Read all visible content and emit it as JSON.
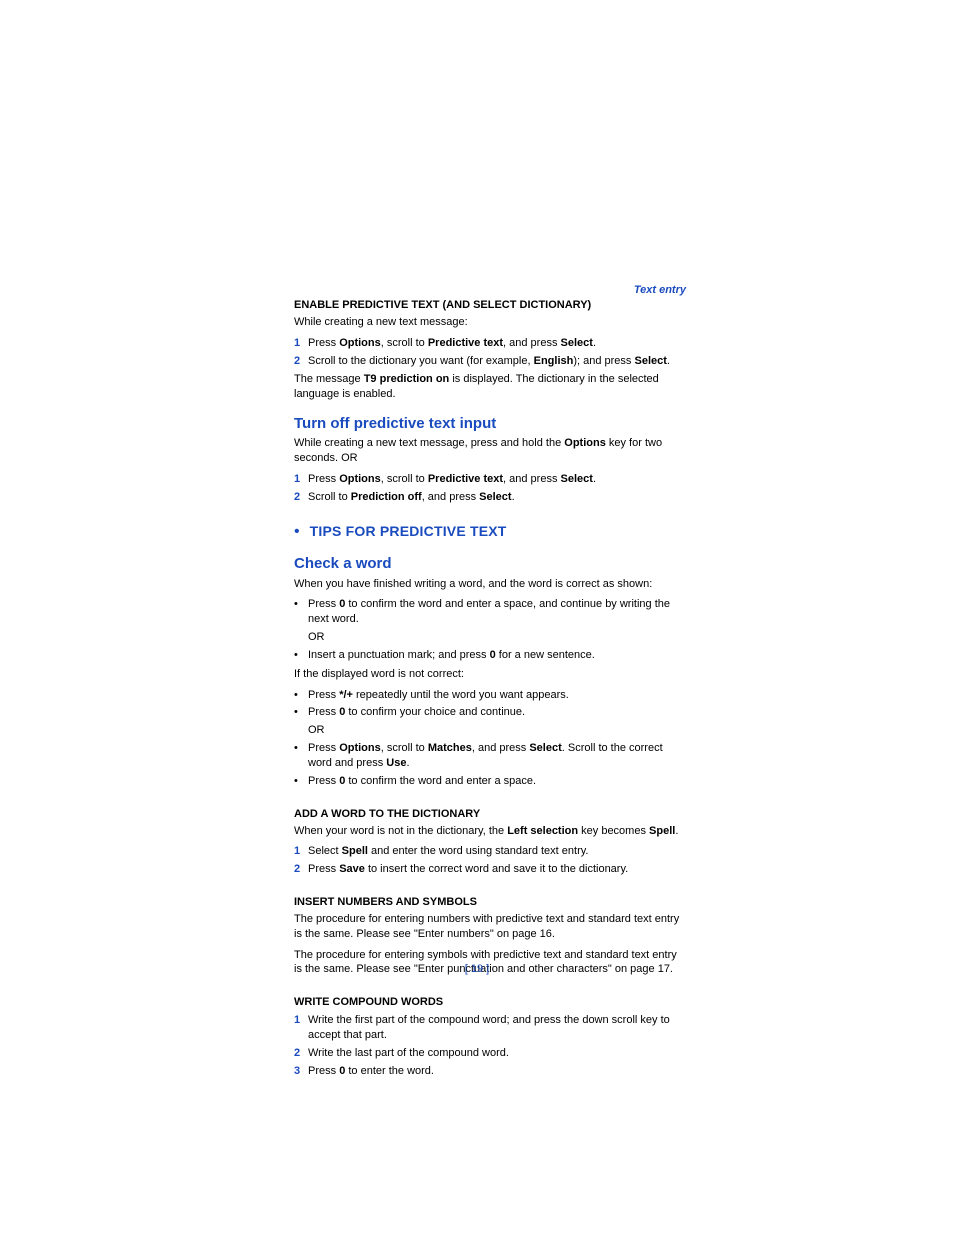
{
  "header": {
    "right": "Text entry"
  },
  "s1": {
    "title": "ENABLE PREDICTIVE TEXT (AND SELECT DICTIONARY)",
    "intro": "While creating a new text message:",
    "step1": {
      "a": "Press ",
      "b": "Options",
      "c": ", scroll to ",
      "d": "Predictive text",
      "e": ", and press ",
      "f": "Select",
      "g": "."
    },
    "step2": {
      "a": "Scroll to the dictionary you want (for example, ",
      "b": "English",
      "c": "); and press ",
      "d": "Select",
      "e": "."
    },
    "after": {
      "a": "The message ",
      "b": "T9 prediction on",
      "c": " is displayed. The dictionary in the selected language is enabled."
    }
  },
  "s2": {
    "title": "Turn off predictive text input",
    "intro": {
      "a": "While creating a new text message, press and hold the ",
      "b": "Options",
      "c": " key for two seconds. OR"
    },
    "step1": {
      "a": "Press ",
      "b": "Options",
      "c": ", scroll to ",
      "d": "Predictive text",
      "e": ", and press ",
      "f": "Select",
      "g": "."
    },
    "step2": {
      "a": "Scroll to ",
      "b": "Prediction off",
      "c": ", and press ",
      "d": "Select",
      "e": "."
    }
  },
  "tips": {
    "title": "TIPS FOR PREDICTIVE TEXT"
  },
  "check": {
    "title": "Check a word",
    "intro": "When you have finished writing a word, and the word is correct as shown:",
    "b1": {
      "a": "Press ",
      "b": "0",
      "c": " to confirm the word and enter a space, and continue by writing the next word."
    },
    "or1": "OR",
    "b2": {
      "a": "Insert a punctuation mark; and press ",
      "b": "0",
      "c": " for a new sentence."
    },
    "mid": "If the displayed word is not correct:",
    "b3": {
      "a": "Press ",
      "b": "*/+",
      "c": " repeatedly until the word you want appears."
    },
    "b4": {
      "a": "Press ",
      "b": "0",
      "c": " to confirm your choice and continue."
    },
    "or2": "OR",
    "b5": {
      "a": "Press ",
      "b": "Options",
      "c": ", scroll to ",
      "d": "Matches",
      "e": ", and press ",
      "f": "Select",
      "g": ". Scroll to the correct word and press ",
      "h": "Use",
      "i": "."
    },
    "b6": {
      "a": "Press ",
      "b": "0",
      "c": " to confirm the word and enter a space."
    }
  },
  "add": {
    "title": "ADD A WORD TO THE DICTIONARY",
    "intro": {
      "a": "When your word is not in the dictionary, the ",
      "b": "Left selection",
      "c": " key becomes ",
      "d": "Spell",
      "e": "."
    },
    "step1": {
      "a": "Select ",
      "b": "Spell",
      "c": " and enter the word using standard text entry."
    },
    "step2": {
      "a": "Press ",
      "b": "Save",
      "c": " to insert the correct word and save it to the dictionary."
    }
  },
  "ins": {
    "title": "INSERT NUMBERS AND SYMBOLS",
    "p1": "The procedure for entering numbers with predictive text and standard text entry is the same. Please see \"Enter numbers\" on page 16.",
    "p2": "The procedure for entering symbols with predictive text and standard text entry is the same. Please see \"Enter punctuation and other characters\" on page 17."
  },
  "comp": {
    "title": "WRITE COMPOUND WORDS",
    "step1": "Write the first part of the compound word; and press the down scroll key to accept that part.",
    "step2": "Write the last part of the compound word.",
    "step3": {
      "a": "Press ",
      "b": "0",
      "c": " to enter the word."
    }
  },
  "page_number": "[ 19 ]",
  "ol_nums": {
    "1": "1",
    "2": "2",
    "3": "3"
  },
  "bullet": "•"
}
